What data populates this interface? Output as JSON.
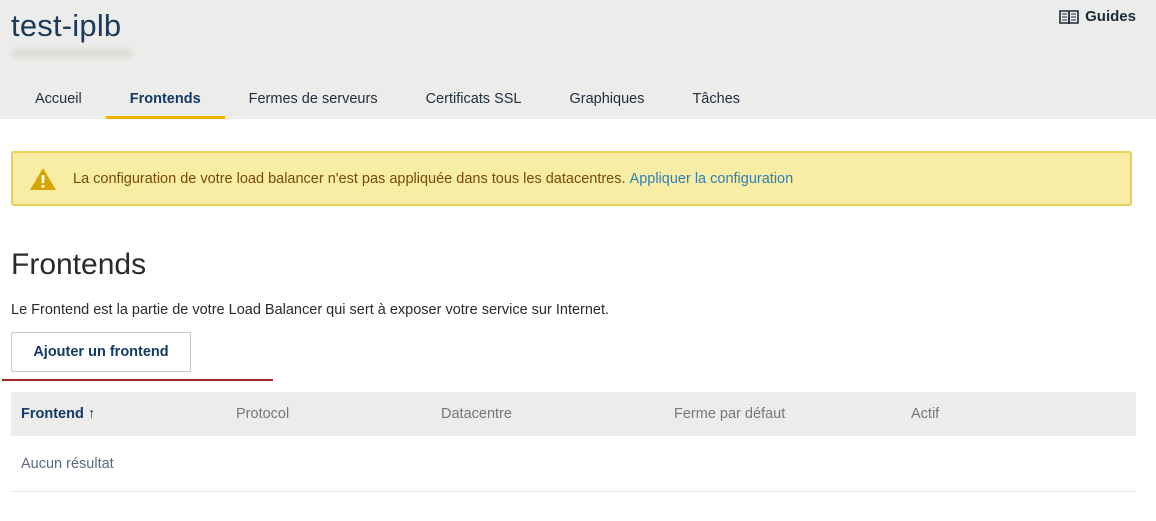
{
  "header": {
    "title": "test-iplb",
    "guides_label": "Guides",
    "tabs": [
      {
        "label": "Accueil"
      },
      {
        "label": "Frontends"
      },
      {
        "label": "Fermes de serveurs"
      },
      {
        "label": "Certificats SSL"
      },
      {
        "label": "Graphiques"
      },
      {
        "label": "Tâches"
      }
    ],
    "active_tab": "Frontends"
  },
  "alert": {
    "message": "La configuration de votre load balancer n'est pas appliquée dans tous les datacentres.",
    "link_label": "Appliquer la configuration",
    "icon": "warning-icon",
    "color": "#f8eda4"
  },
  "section": {
    "title": "Frontends",
    "description": "Le Frontend est la partie de votre Load Balancer qui sert à exposer votre service sur Internet.",
    "add_button_label": "Ajouter un frontend"
  },
  "table": {
    "columns": [
      {
        "label": "Frontend ↑",
        "sorted": true
      },
      {
        "label": "Protocol"
      },
      {
        "label": "Datacentre"
      },
      {
        "label": "Ferme par défaut"
      },
      {
        "label": "Actif"
      }
    ],
    "empty_message": "Aucun résultat"
  },
  "colors": {
    "accent": "#f0b400",
    "header_bg": "#ececea",
    "link": "#2f7fb8",
    "title": "#1b3a5c"
  }
}
